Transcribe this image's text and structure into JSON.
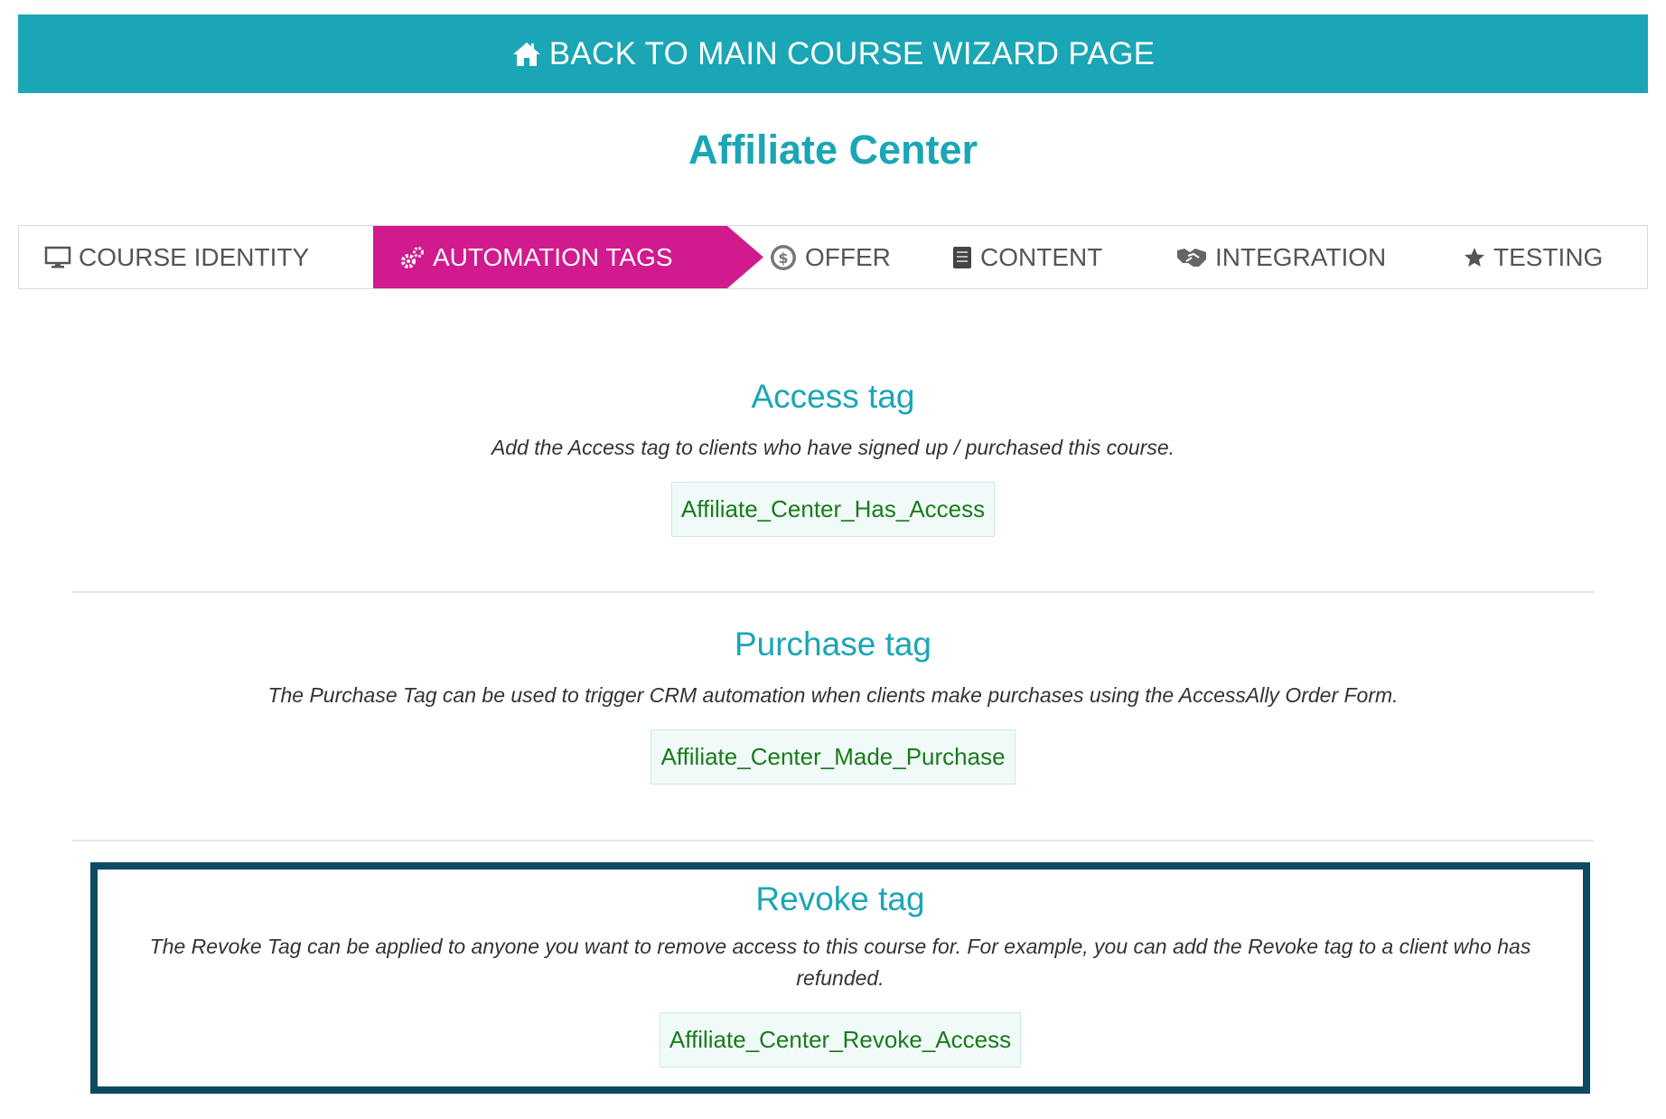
{
  "header": {
    "back_label": "BACK TO MAIN COURSE WIZARD PAGE",
    "back_icon": "home-icon"
  },
  "page": {
    "title": "Affiliate Center"
  },
  "tabs": [
    {
      "label": "COURSE IDENTITY",
      "icon": "monitor-icon",
      "active": false
    },
    {
      "label": "AUTOMATION TAGS",
      "icon": "gears-icon",
      "active": true
    },
    {
      "label": "OFFER",
      "icon": "dollar-circle-icon",
      "active": false
    },
    {
      "label": "CONTENT",
      "icon": "book-icon",
      "active": false
    },
    {
      "label": "INTEGRATION",
      "icon": "handshake-icon",
      "active": false
    },
    {
      "label": "TESTING",
      "icon": "star-icon",
      "active": false
    }
  ],
  "sections": {
    "access": {
      "heading": "Access tag",
      "description": "Add the Access tag to clients who have signed up / purchased this course.",
      "tag": "Affiliate_Center_Has_Access"
    },
    "purchase": {
      "heading": "Purchase tag",
      "description": "The Purchase Tag can be used to trigger CRM automation when clients make purchases using the AccessAlly Order Form.",
      "tag": "Affiliate_Center_Made_Purchase"
    },
    "revoke": {
      "heading": "Revoke tag",
      "description": "The Revoke Tag can be applied to anyone you want to remove access to this course for. For example, you can add the Revoke tag to a client who has refunded.",
      "tag": "Affiliate_Center_Revoke_Access"
    }
  },
  "colors": {
    "primary_teal": "#1aa6b5",
    "active_tab_magenta": "#d11a8d",
    "tag_text_green": "#1a7a1a",
    "highlight_border_navy": "#0e4a64"
  }
}
